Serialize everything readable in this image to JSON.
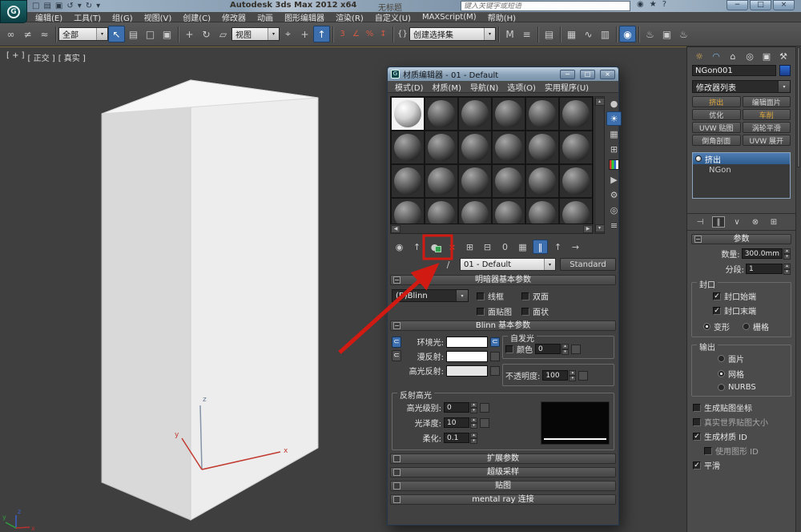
{
  "titlebar": {
    "title": "Autodesk 3ds Max  2012 x64",
    "doc": "无标题",
    "search_placeholder": "键入关键字或短语"
  },
  "menus": [
    "编辑(E)",
    "工具(T)",
    "组(G)",
    "视图(V)",
    "创建(C)",
    "修改器",
    "动画",
    "图形编辑器",
    "渲染(R)",
    "自定义(U)",
    "MAXScript(M)",
    "帮助(H)"
  ],
  "toolbar": {
    "selection_filter": "全部",
    "ref_coord": "视图",
    "named_sel": "创建选择集",
    "snap3": "3",
    "percent": "%",
    "mirror": "M"
  },
  "viewport": {
    "labels": [
      "[ + ]",
      "[ 正交 ]",
      "[ 真实 ]"
    ],
    "axis": {
      "x": "x",
      "y": "y",
      "z": "z"
    }
  },
  "material_editor": {
    "title": "材质编辑器 - 01 - Default",
    "menus": [
      "模式(D)",
      "材质(M)",
      "导航(N)",
      "选项(O)",
      "实用程序(U)"
    ],
    "slots": {
      "count": 24,
      "selected": 0
    },
    "material_name": "01 - Default",
    "type_label": "Standard",
    "shader_rollout": {
      "title": "明暗器基本参数",
      "shader": "(B)Blinn",
      "wire": "线框",
      "two_sided": "双面",
      "face_map": "面贴图",
      "faceted": "面状"
    },
    "blinn_rollout": {
      "title": "Blinn 基本参数",
      "ambient": "环境光:",
      "diffuse": "漫反射:",
      "specular": "高光反射:",
      "self_illum": "自发光",
      "color": "颜色",
      "self_illum_value": "0",
      "opacity": "不透明度:",
      "opacity_value": "100"
    },
    "specular_group": {
      "title": "反射高光",
      "level_label": "高光级别:",
      "level": "0",
      "glossiness_label": "光泽度:",
      "glossiness": "10",
      "soften_label": "柔化:",
      "soften": "0.1"
    },
    "collapsed_rollouts": [
      "扩展参数",
      "超级采样",
      "贴图",
      "mental ray 连接"
    ]
  },
  "command_panel": {
    "object_name": "NGon001",
    "modifier_list": "修改器列表",
    "modifier_buttons": [
      "挤出",
      "编辑面片",
      "优化",
      "车削",
      "UVW 贴图",
      "涡轮平滑",
      "倒角剖面",
      "UVW 展开"
    ],
    "stack": {
      "modifier": "挤出",
      "base": "NGon"
    },
    "parameters": {
      "title": "参数",
      "amount_label": "数量:",
      "amount": "300.0mm",
      "segments_label": "分段:",
      "segments": "1",
      "cap": {
        "title": "封口",
        "start": "封口始端",
        "end": "封口末端",
        "morph": "变形",
        "grid": "栅格"
      },
      "output": {
        "title": "输出",
        "patch": "面片",
        "mesh": "网格",
        "nurbs": "NURBS"
      },
      "gen_mapping": "生成贴图坐标",
      "real_world": "真实世界贴图大小",
      "gen_mat_ids": "生成材质 ID",
      "use_shape_ids": "使用图形 ID",
      "smooth": "平滑"
    }
  },
  "icons": {
    "logo": "G",
    "new": "□",
    "open": "▤",
    "save": "▣",
    "undo": "↺",
    "redo": "↻",
    "dd": "▾",
    "binoculars": "◉",
    "star": "★",
    "help": "?",
    "min": "−",
    "max": "□",
    "close": "×",
    "link": "∞",
    "unlink": "≠",
    "bind": "≈",
    "select": "↖",
    "select_by_name": "▤",
    "rect_region": "□",
    "win_cross": "▣",
    "move": "+",
    "rotate": "↻",
    "scale": "▱",
    "pivot": "⌖",
    "sel_center": "↑",
    "angle": "∠",
    "spin_snap": "↕",
    "sets": "{}",
    "align": "≡",
    "layers": "▤",
    "ribbon": "▦",
    "curve": "∿",
    "schematic": "▥",
    "gear": "⚙",
    "mat_editor": "◉",
    "rframe": "▣",
    "teapot": "♨",
    "up": "▴",
    "down": "▾",
    "left": "◀",
    "right": "▶",
    "check": "✓",
    "get_mtl": "◉",
    "put_scene": "↑",
    "assign": "●",
    "reset": "×",
    "unique": "⊞",
    "library": "⊟",
    "mtl_id": "0",
    "show_map": "▦",
    "show_end": "‖",
    "parent": "↑",
    "forward": "→",
    "sample_type": "●",
    "backlight": "☀",
    "background": "▦",
    "tiling": "⊞",
    "video": "",
    "preview": "▶",
    "options": "⚙",
    "sel_by_mtl": "◎",
    "navigator": "≡",
    "eyedrop": "∕",
    "lock": "⊂",
    "pin": "⊣",
    "stack_show_end": "‖",
    "make_unique": "∨",
    "trash": "⊗",
    "config": "⊞",
    "tab_create": "☼",
    "tab_modify": "◠",
    "tab_hier": "⌂",
    "tab_motion": "◎",
    "tab_display": "▣",
    "tab_util": "⚒"
  }
}
